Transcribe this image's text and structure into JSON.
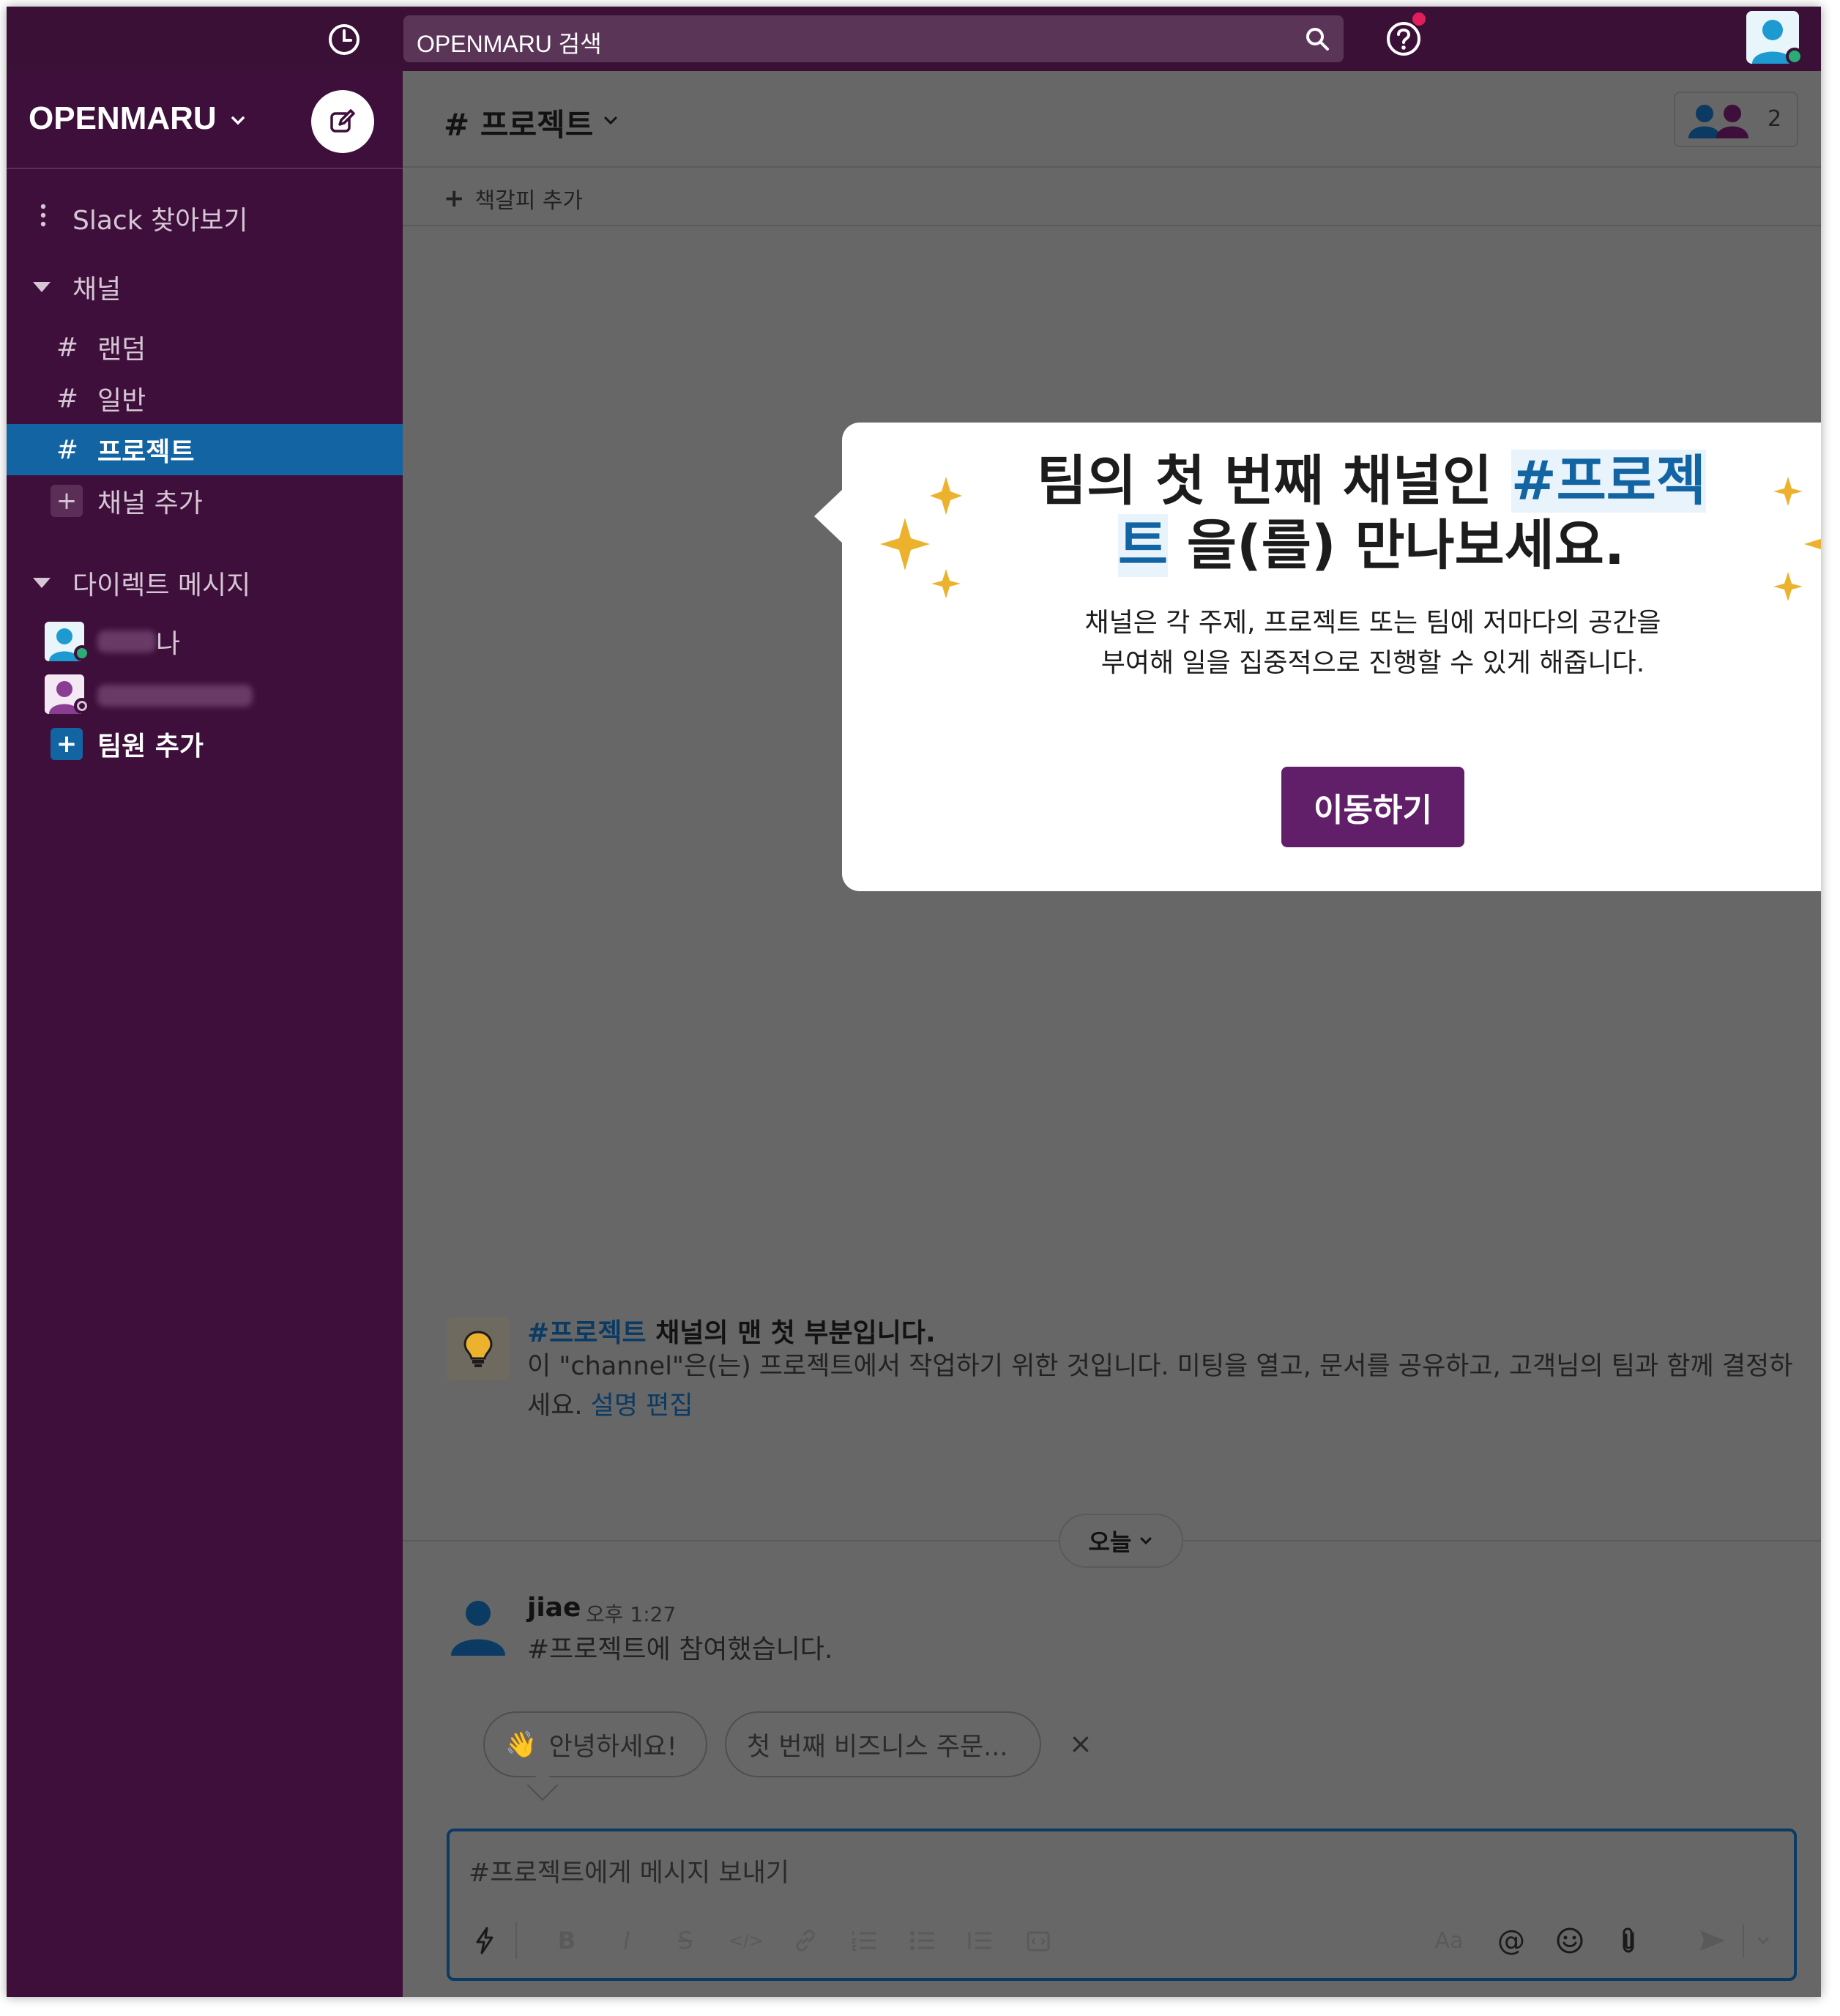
{
  "topbar": {
    "search_placeholder": "OPENMARU 검색",
    "icons": {
      "history": "clock-icon",
      "search": "search-icon",
      "help": "help-icon"
    },
    "help_badge_color": "#e01e5a"
  },
  "sidebar": {
    "workspace_name": "OPENMARU",
    "browse_label": "Slack 찾아보기",
    "channels_header": "채널",
    "channels": [
      {
        "prefix": "#",
        "name": "랜덤"
      },
      {
        "prefix": "#",
        "name": "일반"
      },
      {
        "prefix": "#",
        "name": "프로젝트",
        "selected": true
      }
    ],
    "add_channel_prefix": "+",
    "add_channel_label": "채널 추가",
    "dm_header": "다이렉트 메시지",
    "dms": [
      {
        "name_suffix": "나",
        "status": "active"
      },
      {
        "name_suffix": "",
        "status": "away"
      }
    ],
    "invite_prefix": "+",
    "invite_label": "팀원 추가",
    "colors": {
      "background": "#3d0f3a",
      "selected": "#1264a3"
    }
  },
  "channel": {
    "title": "# 프로젝트",
    "member_count": "2",
    "bookmark_prefix": "+",
    "bookmark_add": "책갈피 추가"
  },
  "popup": {
    "title_prefix": "팀의 첫 번째 채널인 ",
    "title_channel": "#프로젝트",
    "title_suffix": " 을(를) 만나보세요.",
    "description": "채널은 각 주제, 프로젝트 또는 팀에 저마다의 공간을 부여해 일을 집중적으로 진행할 수 있게 해줍니다.",
    "button": "이동하기",
    "accent": "#611f69"
  },
  "intro": {
    "title_channel": "#프로젝트",
    "title_rest": " 채널의 맨 첫 부분입니다.",
    "body": "이 \"channel\"은(는) 프로젝트에서 작업하기 위한 것입니다. 미팅을 열고, 문서를 공유하고, 고객님의 팀과 함께 결정하세요. ",
    "edit_link": "설명 편집"
  },
  "day_divider": "오늘",
  "message": {
    "author": "jiae",
    "time": "오후 1:27",
    "text": "#프로젝트에 참여했습니다."
  },
  "suggestions": {
    "chips": [
      {
        "emoji": "👋",
        "label": "안녕하세요!"
      },
      {
        "label": "첫 번째 비즈니스 주문..."
      }
    ],
    "close": "×"
  },
  "composer": {
    "placeholder": "#프로젝트에게 메시지 보내기",
    "toolbar_labels": {
      "bold": "B",
      "italic": "I",
      "strike": "S",
      "code": "</>",
      "text_size": "Aa",
      "mention": "@"
    }
  }
}
